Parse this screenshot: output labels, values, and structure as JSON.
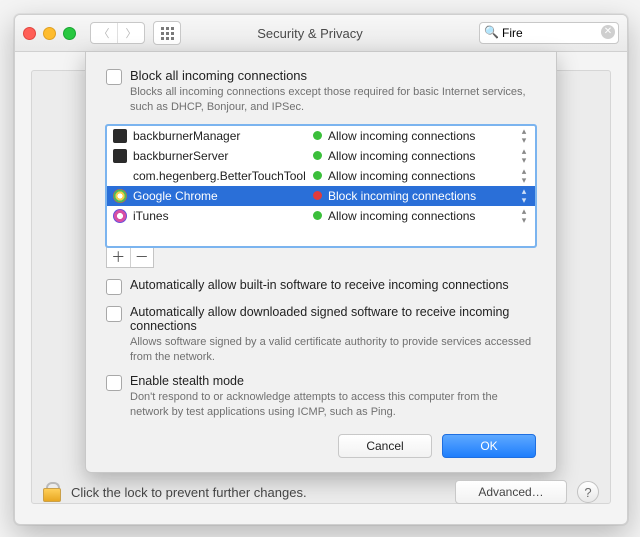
{
  "window": {
    "title": "Security & Privacy",
    "search_value": "Fire"
  },
  "sheet": {
    "block_all": {
      "label": "Block all incoming connections",
      "desc": "Blocks all incoming connections except those required for basic Internet services,  such as DHCP, Bonjour, and IPSec."
    },
    "apps": [
      {
        "name": "backburnerManager",
        "status": "Allow incoming connections",
        "color": "green",
        "icon": "app-dark",
        "selected": false
      },
      {
        "name": "backburnerServer",
        "status": "Allow incoming connections",
        "color": "green",
        "icon": "app-dark",
        "selected": false
      },
      {
        "name": "com.hegenberg.BetterTouchTool",
        "status": "Allow incoming connections",
        "color": "green",
        "icon": "none",
        "selected": false
      },
      {
        "name": "Google Chrome",
        "status": "Block incoming connections",
        "color": "red",
        "icon": "chrome",
        "selected": true
      },
      {
        "name": "iTunes",
        "status": "Allow incoming connections",
        "color": "green",
        "icon": "itunes",
        "selected": false
      }
    ],
    "auto_builtin": "Automatically allow built-in software to receive incoming connections",
    "auto_signed": {
      "label": "Automatically allow downloaded signed software to receive incoming connections",
      "desc": "Allows software signed by a valid certificate authority to provide services accessed from the network."
    },
    "stealth": {
      "label": "Enable stealth mode",
      "desc": "Don't respond to or acknowledge attempts to access this computer from the network by test applications using ICMP, such as Ping."
    },
    "buttons": {
      "cancel": "Cancel",
      "ok": "OK"
    }
  },
  "footer": {
    "lock_text": "Click the lock to prevent further changes.",
    "advanced": "Advanced…"
  }
}
